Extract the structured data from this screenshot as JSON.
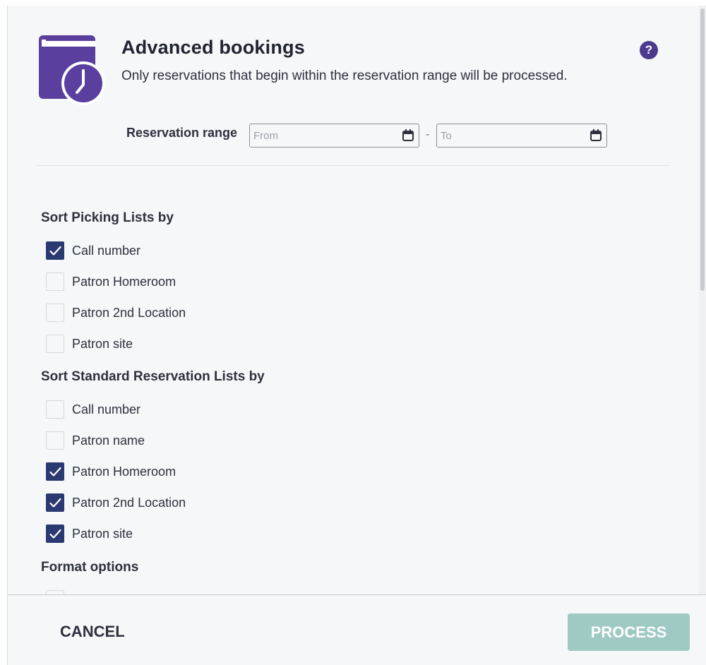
{
  "header": {
    "title": "Advanced bookings",
    "subtitle": "Only reservations that begin within the reservation range will be processed.",
    "icon": "calendar-clock-icon",
    "help_icon": "question-mark-icon",
    "help_glyph": "?",
    "accent_color": "#5a3f9e"
  },
  "reservation_range": {
    "label": "Reservation range",
    "from_placeholder": "From",
    "from_value": "",
    "separator": "-",
    "to_placeholder": "To",
    "to_value": ""
  },
  "sections": [
    {
      "title": "Sort Picking Lists by",
      "options": [
        {
          "label": "Call number",
          "checked": true
        },
        {
          "label": "Patron Homeroom",
          "checked": false
        },
        {
          "label": "Patron 2nd Location",
          "checked": false
        },
        {
          "label": "Patron site",
          "checked": false
        }
      ]
    },
    {
      "title": "Sort Standard Reservation Lists by",
      "options": [
        {
          "label": "Call number",
          "checked": false
        },
        {
          "label": "Patron name",
          "checked": false
        },
        {
          "label": "Patron Homeroom",
          "checked": true
        },
        {
          "label": "Patron 2nd Location",
          "checked": true
        },
        {
          "label": "Patron site",
          "checked": true
        }
      ]
    },
    {
      "title": "Format options",
      "options": []
    }
  ],
  "footer": {
    "cancel_label": "CANCEL",
    "process_label": "PROCESS",
    "process_color": "#9fc9c3",
    "checkbox_checked_color": "#2a3970"
  }
}
